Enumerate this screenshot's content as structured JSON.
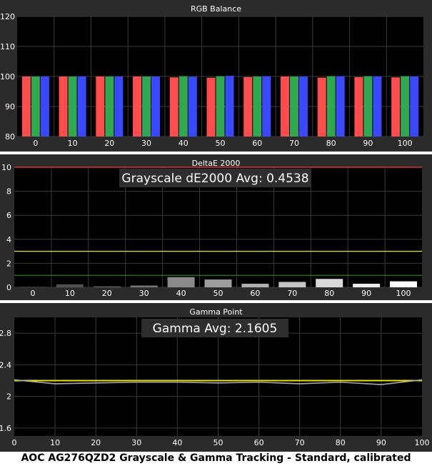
{
  "colors": {
    "panel_bg": "#2b2b2b",
    "plot_bg": "#000000",
    "grid": "#3a3a3a",
    "text": "#ffffff",
    "red": "#ff4d4d",
    "green": "#2fa84f",
    "blue": "#3a48ff",
    "reference_red": "#ff3a3a",
    "threshold_yellow": "#e6e600",
    "threshold_green": "#2a8a2a",
    "gamma_line": "#e8e600",
    "gamma_measured": "#a8a8a8"
  },
  "caption": "AOC AG276QZD2 Grayscale & Gamma Tracking - Standard, calibrated",
  "chart_data": [
    {
      "type": "bar",
      "title": "RGB Balance",
      "categories": [
        "0",
        "10",
        "20",
        "30",
        "40",
        "50",
        "60",
        "70",
        "80",
        "90",
        "100"
      ],
      "ylim": [
        80,
        120
      ],
      "yticks": [
        80,
        90,
        100,
        110,
        120
      ],
      "grid": true,
      "series": [
        {
          "name": "Red",
          "color": "#ff4d4d",
          "values": [
            100,
            100,
            100,
            100,
            99.7,
            99.6,
            99.8,
            100,
            99.6,
            99.8,
            99.7
          ]
        },
        {
          "name": "Green",
          "color": "#2fa84f",
          "values": [
            100,
            100,
            100,
            100,
            100.1,
            100.1,
            100,
            100,
            100.1,
            100.1,
            100.1
          ]
        },
        {
          "name": "Blue",
          "color": "#3a48ff",
          "values": [
            100,
            100,
            100,
            100,
            99.9,
            100.2,
            100.1,
            100,
            100.1,
            100,
            100
          ]
        }
      ]
    },
    {
      "type": "bar",
      "title": "DeltaE 2000",
      "annotation": "Grayscale dE2000 Avg: 0.4538",
      "categories": [
        "0",
        "10",
        "20",
        "30",
        "40",
        "50",
        "60",
        "70",
        "80",
        "90",
        "100"
      ],
      "values": [
        0.05,
        0.25,
        0.08,
        0.15,
        0.85,
        0.65,
        0.3,
        0.45,
        0.7,
        0.3,
        0.5
      ],
      "ylim": [
        0,
        10
      ],
      "yticks": [
        0,
        2,
        4,
        6,
        8,
        10
      ],
      "reference_lines": [
        {
          "value": 10,
          "color": "#ff3a3a"
        },
        {
          "value": 3,
          "color": "#e6e600"
        },
        {
          "value": 1,
          "color": "#2a8a2a"
        }
      ],
      "grid": true
    },
    {
      "type": "line",
      "title": "Gamma Point",
      "annotation": "Gamma Avg: 2.1605",
      "x": [
        0,
        10,
        20,
        30,
        40,
        50,
        60,
        70,
        80,
        90,
        100
      ],
      "xticks": [
        0,
        10,
        20,
        30,
        40,
        50,
        60,
        70,
        80,
        90,
        100
      ],
      "xlim": [
        0,
        100
      ],
      "ylim": [
        1.5,
        3.0
      ],
      "yticks": [
        1.6,
        2,
        2.4,
        2.8
      ],
      "ytick_labels": [
        "1.6",
        "2",
        "2.4",
        "2.8"
      ],
      "grid": true,
      "series": [
        {
          "name": "Target",
          "color": "#e8e600",
          "values": [
            2.2,
            2.2,
            2.2,
            2.2,
            2.2,
            2.2,
            2.2,
            2.2,
            2.2,
            2.2,
            2.2
          ]
        },
        {
          "name": "Measured",
          "color": "#a8a8a8",
          "values": [
            2.21,
            2.16,
            2.17,
            2.18,
            2.18,
            2.17,
            2.18,
            2.16,
            2.18,
            2.15,
            2.21
          ]
        }
      ]
    }
  ]
}
